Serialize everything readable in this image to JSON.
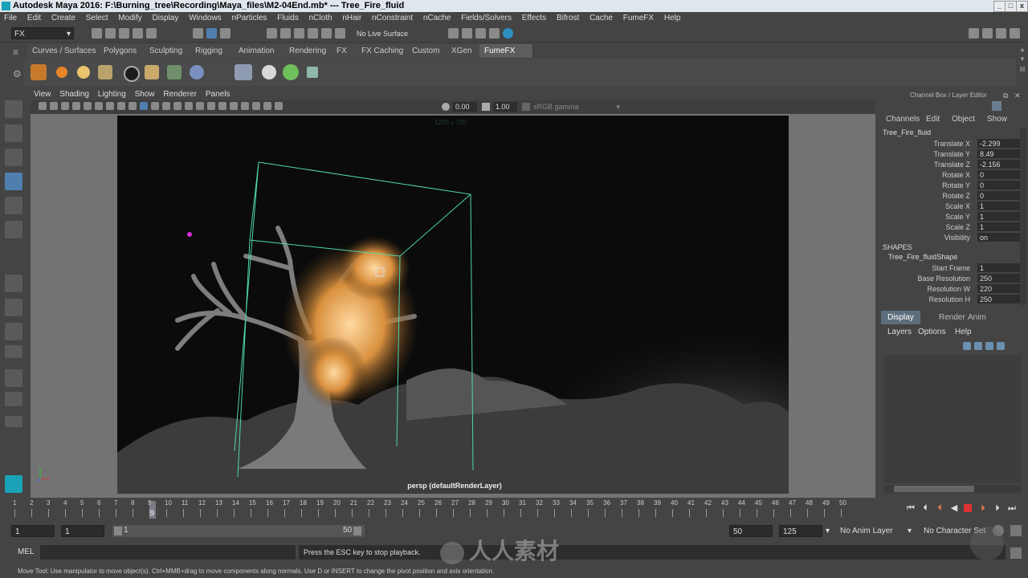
{
  "window": {
    "title": "Autodesk Maya 2016: F:\\Burning_tree\\Recording\\Maya_files\\M2-04End.mb*   ---   Tree_Fire_fluid",
    "minimize": "_",
    "maximize": "□",
    "close": "x"
  },
  "menu": [
    "File",
    "Edit",
    "Create",
    "Select",
    "Modify",
    "Display",
    "Windows",
    "nParticles",
    "Fluids",
    "nCloth",
    "nHair",
    "nConstraint",
    "nCache",
    "Fields/Solvers",
    "Effects",
    "Bifrost",
    "Cache",
    "FumeFX",
    "Help"
  ],
  "statusline": {
    "menuset": "FX",
    "live_surface": "No Live Surface"
  },
  "shelf_tabs": [
    "Curves / Surfaces",
    "Polygons",
    "Sculpting",
    "Rigging",
    "Animation",
    "Rendering",
    "FX",
    "FX Caching",
    "Custom",
    "XGen",
    "FumeFX"
  ],
  "active_shelf": "FumeFX",
  "panel_menu": [
    "View",
    "Shading",
    "Lighting",
    "Show",
    "Renderer",
    "Panels"
  ],
  "panel_toolbar": {
    "exposure": "0.00",
    "gamma": "1.00",
    "colorspace": "sRGB gamma"
  },
  "viewport": {
    "resolution_label": "1280 x 720",
    "camera_label": "persp (defaultRenderLayer)"
  },
  "channel_box": {
    "header": "Channel Box / Layer Editor",
    "menus": [
      "Channels",
      "Edit",
      "Object",
      "Show"
    ],
    "object_name": "Tree_Fire_fluid",
    "attrs": [
      {
        "label": "Translate X",
        "value": "-2.299"
      },
      {
        "label": "Translate Y",
        "value": "8.49"
      },
      {
        "label": "Translate Z",
        "value": "-2.156"
      },
      {
        "label": "Rotate X",
        "value": "0"
      },
      {
        "label": "Rotate Y",
        "value": "0"
      },
      {
        "label": "Rotate Z",
        "value": "0"
      },
      {
        "label": "Scale X",
        "value": "1"
      },
      {
        "label": "Scale Y",
        "value": "1"
      },
      {
        "label": "Scale Z",
        "value": "1"
      },
      {
        "label": "Visibility",
        "value": "on"
      }
    ],
    "shapes_header": "SHAPES",
    "shape_name": "Tree_Fire_fluidShape",
    "shape_attrs": [
      {
        "label": "Start Frame",
        "value": "1"
      },
      {
        "label": "Base Resolution",
        "value": "250"
      },
      {
        "label": "Resolution W",
        "value": "220"
      },
      {
        "label": "Resolution H",
        "value": "250"
      }
    ]
  },
  "layer_editor": {
    "tabs": [
      "Display",
      "Render",
      "Anim"
    ],
    "menus": [
      "Layers",
      "Options",
      "Help"
    ]
  },
  "timeline": {
    "ticks": [
      "1",
      "2",
      "3",
      "4",
      "5",
      "6",
      "7",
      "8",
      "9",
      "10",
      "11",
      "12",
      "13",
      "14",
      "15",
      "16",
      "17",
      "18",
      "19",
      "20",
      "21",
      "22",
      "23",
      "24",
      "25",
      "26",
      "27",
      "28",
      "29",
      "30",
      "31",
      "32",
      "33",
      "34",
      "35",
      "36",
      "37",
      "38",
      "39",
      "40",
      "41",
      "42",
      "43",
      "44",
      "45",
      "46",
      "47",
      "48",
      "49",
      "50"
    ],
    "current_frame": "9"
  },
  "range": {
    "start": "1",
    "anim_start": "1",
    "slider_start": "1",
    "slider_end": "50",
    "anim_end": "50",
    "end": "125",
    "anim_layer": "No Anim Layer",
    "character_set": "No Character Set"
  },
  "command": {
    "lang": "MEL",
    "result": "Press the ESC key to stop playback."
  },
  "help_line": "Move Tool: Use manipulator to move object(s). Ctrl+MMB+drag to move components along normals. Use D or INSERT to change the pivot position and axis orientation.",
  "watermark": "人人素材"
}
